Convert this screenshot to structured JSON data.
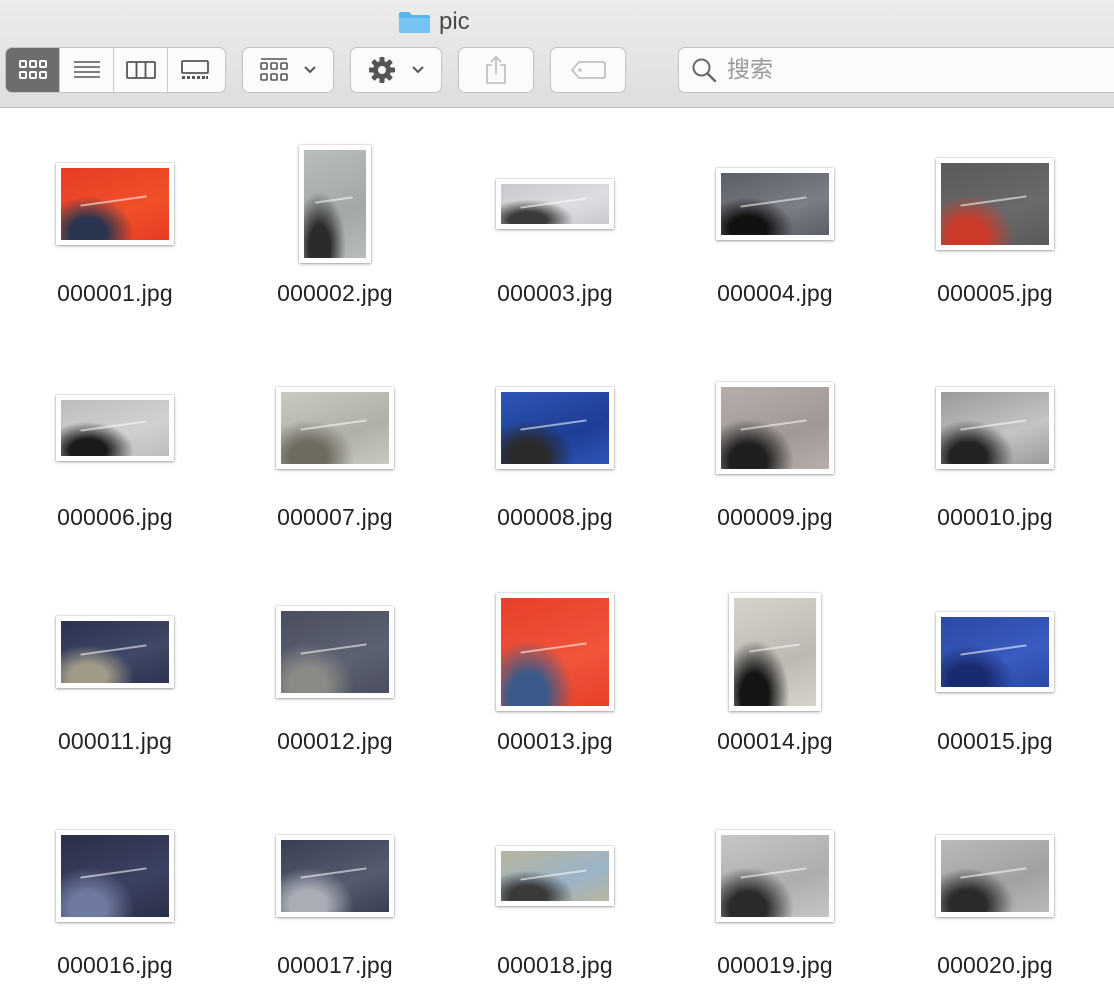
{
  "window": {
    "title": "pic"
  },
  "toolbar": {
    "view_modes": [
      {
        "name": "icon-view-button",
        "icon": "icon-grid-icon",
        "active": true
      },
      {
        "name": "list-view-button",
        "icon": "list-icon",
        "active": false
      },
      {
        "name": "column-view-button",
        "icon": "columns-icon",
        "active": false
      },
      {
        "name": "gallery-view-button",
        "icon": "gallery-icon",
        "active": false
      }
    ],
    "group_button_icon": "group-grid-icon",
    "action_button_icon": "gear-icon",
    "share_button_icon": "share-icon",
    "tag_button_icon": "tag-icon",
    "search": {
      "placeholder": "搜索",
      "value": ""
    }
  },
  "files": [
    {
      "name": "000001.jpg",
      "colors": [
        "#e83c23",
        "#f0502a",
        "#2a3550"
      ]
    },
    {
      "name": "000002.jpg",
      "colors": [
        "#b9bcbd",
        "#a3a7a8",
        "#2b2b2b"
      ]
    },
    {
      "name": "000003.jpg",
      "colors": [
        "#c9c9cd",
        "#dcdde0",
        "#3a3a3a"
      ]
    },
    {
      "name": "000004.jpg",
      "colors": [
        "#5c5e66",
        "#7c7e86",
        "#111111"
      ]
    },
    {
      "name": "000005.jpg",
      "colors": [
        "#5a5a5a",
        "#6a6a6a",
        "#cc3a2a"
      ]
    },
    {
      "name": "000006.jpg",
      "colors": [
        "#bdbdbd",
        "#d0d0d0",
        "#1a1a1a"
      ]
    },
    {
      "name": "000007.jpg",
      "colors": [
        "#c9c9c1",
        "#b0b0a6",
        "#6d6a60"
      ]
    },
    {
      "name": "000008.jpg",
      "colors": [
        "#2e55b8",
        "#1e3e96",
        "#2a2a2a"
      ]
    },
    {
      "name": "000009.jpg",
      "colors": [
        "#b6aeaa",
        "#a09894",
        "#1f1f1f"
      ]
    },
    {
      "name": "000010.jpg",
      "colors": [
        "#9a9a9c",
        "#c4c4c6",
        "#222222"
      ]
    },
    {
      "name": "000011.jpg",
      "colors": [
        "#2c3350",
        "#3f4866",
        "#a09a88"
      ]
    },
    {
      "name": "000012.jpg",
      "colors": [
        "#4a4e5e",
        "#5d6273",
        "#8a8a86"
      ]
    },
    {
      "name": "000013.jpg",
      "colors": [
        "#e8402a",
        "#f0553a",
        "#3a5a8a"
      ]
    },
    {
      "name": "000014.jpg",
      "colors": [
        "#d6d2cc",
        "#bcb8b2",
        "#141414"
      ]
    },
    {
      "name": "000015.jpg",
      "colors": [
        "#2a4aa8",
        "#3a5cc0",
        "#1a2a70"
      ]
    },
    {
      "name": "000016.jpg",
      "colors": [
        "#2b3048",
        "#3b4162",
        "#6f7aa0"
      ]
    },
    {
      "name": "000017.jpg",
      "colors": [
        "#3a3f50",
        "#565c70",
        "#a9adb6"
      ]
    },
    {
      "name": "000018.jpg",
      "colors": [
        "#b8b49c",
        "#9ab4c8",
        "#3a3a3a"
      ]
    },
    {
      "name": "000019.jpg",
      "colors": [
        "#c6c6c8",
        "#adadb0",
        "#2a2a2a"
      ]
    },
    {
      "name": "000020.jpg",
      "colors": [
        "#b9b9bb",
        "#a1a1a3",
        "#2a2a2a"
      ]
    }
  ]
}
